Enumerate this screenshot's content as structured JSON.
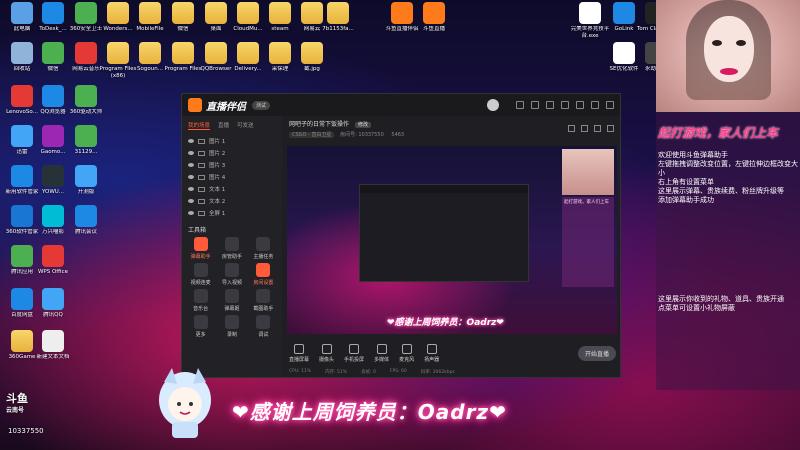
{
  "desktop": {
    "icons": [
      {
        "label": "此电脑",
        "color": "#5aa0e6"
      },
      {
        "label": "ToDesk_...",
        "color": "#1e88e5"
      },
      {
        "label": "360安全卫士",
        "color": "#4caf50"
      },
      {
        "label": "Wonders...",
        "color": "folder"
      },
      {
        "label": "MobileFile",
        "color": "folder"
      },
      {
        "label": "微信",
        "color": "folder"
      },
      {
        "label": "桌面",
        "color": "folder"
      },
      {
        "label": "CloudMu...",
        "color": "folder"
      },
      {
        "label": "steam",
        "color": "folder"
      },
      {
        "label": "网易云",
        "color": "folder"
      },
      {
        "label": "7b1153fa...",
        "color": "folder"
      },
      {
        "label": "斗鱼直播伴侣",
        "color": "#ff7a1a"
      },
      {
        "label": "斗鱼直播",
        "color": "#ff7a1a"
      },
      {
        "label": "完美世界竞技平台.exe",
        "color": "#ffffff"
      },
      {
        "label": "GoLink",
        "color": "#1e88e5"
      },
      {
        "label": "Tom Clancy'...",
        "color": "#222"
      },
      {
        "label": "回收站",
        "color": "#8fb3d9"
      },
      {
        "label": "微信",
        "color": "#4caf50"
      },
      {
        "label": "网易云音乐",
        "color": "#e53935"
      },
      {
        "label": "Program Files (x86)",
        "color": "folder"
      },
      {
        "label": "Sogoun...",
        "color": "folder"
      },
      {
        "label": "Program Files",
        "color": "folder"
      },
      {
        "label": "QQBrowser",
        "color": "folder"
      },
      {
        "label": "Delivery...",
        "color": "folder"
      },
      {
        "label": "采保理",
        "color": "folder"
      },
      {
        "label": "截.jpg",
        "color": "folder"
      },
      {
        "label": "SE优化软件",
        "color": "#ffffff"
      },
      {
        "label": "永劫无间",
        "color": "#444"
      },
      {
        "label": "LenovoSo...",
        "color": "#e53935"
      },
      {
        "label": "QQ浏览器",
        "color": "#1e88e5"
      },
      {
        "label": "360驱动大师",
        "color": "#4caf50"
      },
      {
        "label": "迅雷",
        "color": "#42a5f5"
      },
      {
        "label": "Gaomo...",
        "color": "#9c27b0"
      },
      {
        "label": "31129...",
        "color": "#4caf50"
      },
      {
        "label": "新用软件管家",
        "color": "#1e88e5"
      },
      {
        "label": "YOWU...",
        "color": "#263238"
      },
      {
        "label": "开测版",
        "color": "#42a5f5"
      },
      {
        "label": "360软件管家",
        "color": "#1976d2"
      },
      {
        "label": "万兴喵影",
        "color": "#00bcd4"
      },
      {
        "label": "腾讯会议",
        "color": "#1e88e5"
      },
      {
        "label": "腾讯应用",
        "color": "#4caf50"
      },
      {
        "label": "WPS Office",
        "color": "#e53935"
      },
      {
        "label": "百度网盘",
        "color": "#1e88e5"
      },
      {
        "label": "腾讯QQ",
        "color": "#42a5f5"
      },
      {
        "label": "360Game",
        "color": "folder"
      },
      {
        "label": "新建文本文档",
        "color": "#eeeeee"
      }
    ]
  },
  "app": {
    "name": "直播伴侣",
    "version": "测试",
    "tabs": [
      "我的场景",
      "直播",
      "可发送"
    ],
    "scenes": [
      "图片 1",
      "图片 2",
      "图片 3",
      "图片 4",
      "文本 1",
      "文本 2",
      "全屏 1"
    ],
    "tools_title": "工具箱",
    "tools": [
      {
        "label": "弹幕助手",
        "hot": true
      },
      {
        "label": "房管助手",
        "hot": false
      },
      {
        "label": "主播任务",
        "hot": false
      },
      {
        "label": "视频连麦",
        "hot": false
      },
      {
        "label": "导入视频",
        "hot": false
      },
      {
        "label": "房间设置",
        "hot": true
      },
      {
        "label": "音乐台",
        "hot": false
      },
      {
        "label": "弹幕姬",
        "hot": false
      },
      {
        "label": "截图助手",
        "hot": false
      },
      {
        "label": "更多",
        "hot": false
      },
      {
        "label": "录制",
        "hot": false
      },
      {
        "label": "调试",
        "hot": false
      }
    ],
    "room": {
      "title": "网吧子的日常下饭操作",
      "edit": "修改",
      "category": "CSGO - 直白卫星",
      "room_label": "房间号: 10337550",
      "viewers": "5463"
    },
    "preview": {
      "banner": "❤感谢上周饲养员：Oadrz❤",
      "cam_caption": "起打游戏，家人们上车"
    },
    "bottom": [
      "直播屏幕",
      "摄像头",
      "手机投屏",
      "多媒体",
      "麦克风",
      "扬声器"
    ],
    "go_live": "开始直播",
    "status": [
      "CPU: 11%",
      "内存: 51%",
      "丢帧: 0",
      "FPS: 60",
      "码率: 3062kbps"
    ]
  },
  "right": {
    "cam_caption": "起打游戏，家人们上车",
    "help_lines": [
      "欢迎使用斗鱼弹幕助手",
      "左键拖拽调整改变位置，左键拉伸边框改变大小",
      "右上角有设置菜单",
      "这里展示弹幕、贵族续费、粉丝牌升级等",
      "添加弹幕助手成功"
    ],
    "help_lines2": [
      "这里展示你收到的礼物、道具、贵族开通",
      "点菜单可设置小礼物屏蔽"
    ]
  },
  "overlay": {
    "brand": "斗鱼",
    "brand_sub": "云南号",
    "room_no": "10337550",
    "banner": "❤感谢上周饲养员：Oadrz❤"
  }
}
